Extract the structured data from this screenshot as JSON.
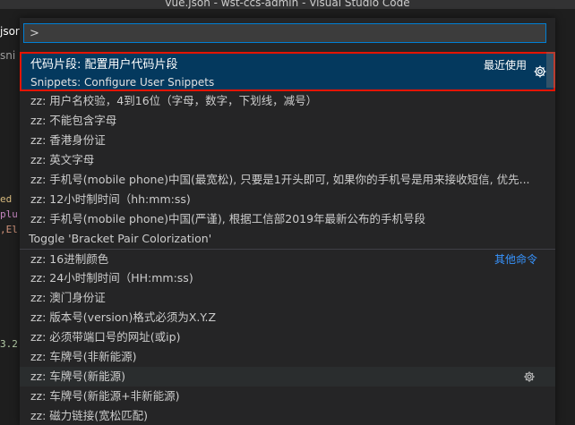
{
  "window": {
    "title": "vue.json - wst-ccs-admin - Visual Studio Code"
  },
  "background": {
    "tab_label": "jsor",
    "snip_label": "sni",
    "code_lines": [
      "ed",
      "plu",
      ",El",
      "3.2"
    ]
  },
  "quick_pick": {
    "search_value": ">",
    "selected": {
      "title": "代码片段: 配置用户代码片段",
      "subtitle": "Snippets: Configure User Snippets",
      "badge": "最近使用"
    },
    "items_group1": [
      "zz: 用户名校验，4到16位（字母，数字，下划线，减号）",
      "zz: 不能包含字母",
      "zz: 香港身份证",
      "zz: 英文字母",
      "zz: 手机号(mobile phone)中国(最宽松), 只要是1开头即可, 如果你的手机号是用来接收短信, 优先...",
      "zz: 12小时制时间（hh:mm:ss)",
      "zz: 手机号(mobile phone)中国(严谨), 根据工信部2019年最新公布的手机号段"
    ],
    "toggle_item": "Toggle 'Bracket Pair Colorization'",
    "other_commands_label": "其他命令",
    "items_group2": [
      "zz: 16进制颜色",
      "zz: 24小时制时间（HH:mm:ss)",
      "zz: 澳门身份证",
      "zz: 版本号(version)格式必须为X.Y.Z",
      "zz: 必须带端口号的网址(或ip)",
      "zz: 车牌号(非新能源)",
      "zz: 车牌号(新能源)",
      "zz: 车牌号(新能源+非新能源)",
      "zz: 磁力链接(宽松匹配)"
    ]
  },
  "colors": {
    "selection_bg": "#04395e",
    "highlight_border": "#e51400",
    "focus_border": "#007fd4",
    "link_blue": "#3794ff"
  }
}
